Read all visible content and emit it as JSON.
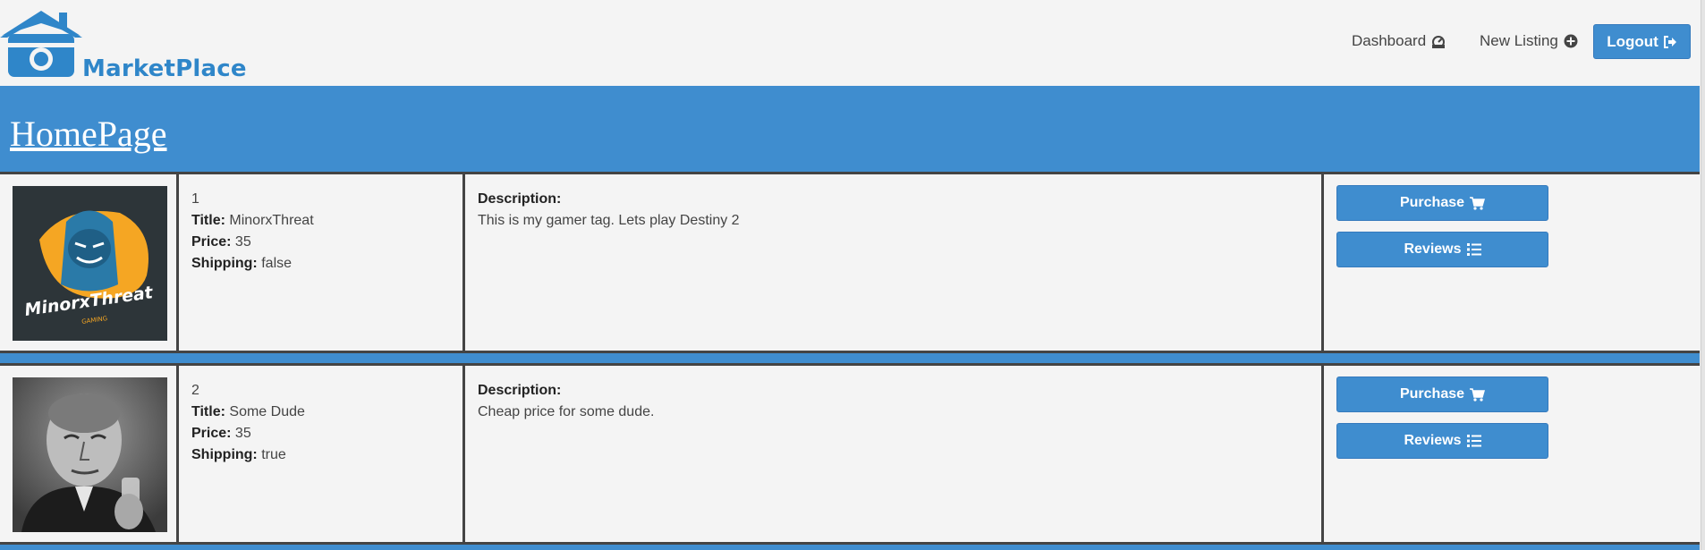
{
  "brand": {
    "name": "MarketPlace",
    "logo_icon": "house-camera-icon"
  },
  "nav": {
    "dashboard": {
      "label": "Dashboard",
      "icon": "tachometer-icon"
    },
    "new_listing": {
      "label": "New Listing",
      "icon": "plus-circle-icon"
    },
    "logout": {
      "label": "Logout",
      "icon": "sign-out-icon"
    }
  },
  "banner": {
    "title": "HomePage"
  },
  "labels": {
    "title": "Title:",
    "price": "Price:",
    "shipping": "Shipping:",
    "description": "Description:",
    "purchase": "Purchase",
    "reviews": "Reviews"
  },
  "listings": [
    {
      "id": "1",
      "title": "MinorxThreat",
      "price": "35",
      "shipping": "false",
      "description": "This is my gamer tag. Lets play Destiny 2",
      "image": "gaming-logo-image",
      "image_text": "MinorxThreat",
      "image_subtext": "GAMING"
    },
    {
      "id": "2",
      "title": "Some Dude",
      "price": "35",
      "shipping": "true",
      "description": "Cheap price for some dude.",
      "image": "black-and-white-man-photo"
    }
  ],
  "colors": {
    "accent": "#3f8dcf",
    "background": "#f4f4f4",
    "border": "#444444",
    "brand_text": "#2f86c9"
  }
}
